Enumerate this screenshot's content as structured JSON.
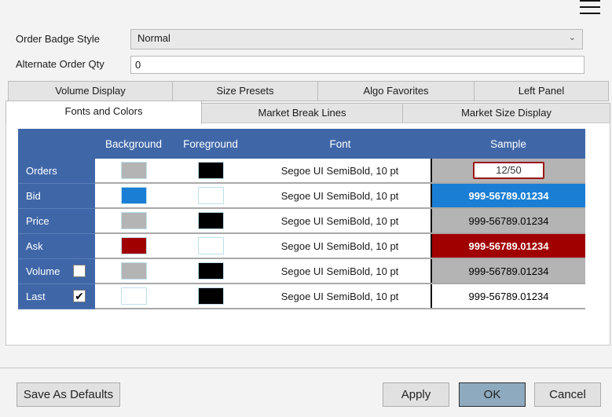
{
  "toolbar": {
    "menu_icon": "hamburger-menu-icon"
  },
  "settings": {
    "order_badge_style": {
      "label": "Order Badge Style",
      "value": "Normal"
    },
    "alternate_order_qty": {
      "label": "Alternate Order Qty",
      "value": "0"
    }
  },
  "tabs": {
    "row1": [
      "Volume Display",
      "Size Presets",
      "Algo Favorites",
      "Left Panel"
    ],
    "row2": [
      "Fonts and Colors",
      "Market Break Lines",
      "Market Size Display"
    ],
    "active": "Fonts and Colors"
  },
  "grid": {
    "headers": [
      "",
      "Background",
      "Foreground",
      "Font",
      "Sample"
    ],
    "rows": [
      {
        "label": "Orders",
        "background": "#b4b4b4",
        "foreground": "#000000",
        "font": "Segoe UI SemiBold, 10 pt",
        "sample": "12/50",
        "sample_bg": "#b4b4b4",
        "sample_fg": "#333333"
      },
      {
        "label": "Bid",
        "background": "#1a7fd4",
        "foreground": "#ffffff",
        "font": "Segoe UI SemiBold, 10 pt",
        "sample": "999-56789.01234",
        "sample_bg": "#1a7fd4",
        "sample_fg": "#ffffff"
      },
      {
        "label": "Price",
        "background": "#b4b4b4",
        "foreground": "#000000",
        "font": "Segoe UI SemiBold, 10 pt",
        "sample": "999-56789.01234",
        "sample_bg": "#b4b4b4",
        "sample_fg": "#000000"
      },
      {
        "label": "Ask",
        "background": "#a00000",
        "foreground": "#ffffff",
        "font": "Segoe UI SemiBold, 10 pt",
        "sample": "999-56789.01234",
        "sample_bg": "#a00000",
        "sample_fg": "#ffffff"
      },
      {
        "label": "Volume",
        "checkbox": false,
        "background": "#b4b4b4",
        "foreground": "#000000",
        "font": "Segoe UI SemiBold, 10 pt",
        "sample": "999-56789.01234",
        "sample_bg": "#b4b4b4",
        "sample_fg": "#000000"
      },
      {
        "label": "Last",
        "checkbox": true,
        "background": "#ffffff",
        "foreground": "#000000",
        "font": "Segoe UI SemiBold, 10 pt",
        "sample": "999-56789.01234",
        "sample_bg": "#ffffff",
        "sample_fg": "#000000"
      }
    ]
  },
  "footer": {
    "save_defaults": "Save As Defaults",
    "apply": "Apply",
    "ok": "OK",
    "cancel": "Cancel"
  },
  "colors": {
    "header_blue": "#3f67a8",
    "ok_button": "#8eaabf",
    "badge_border": "#9a1515"
  }
}
